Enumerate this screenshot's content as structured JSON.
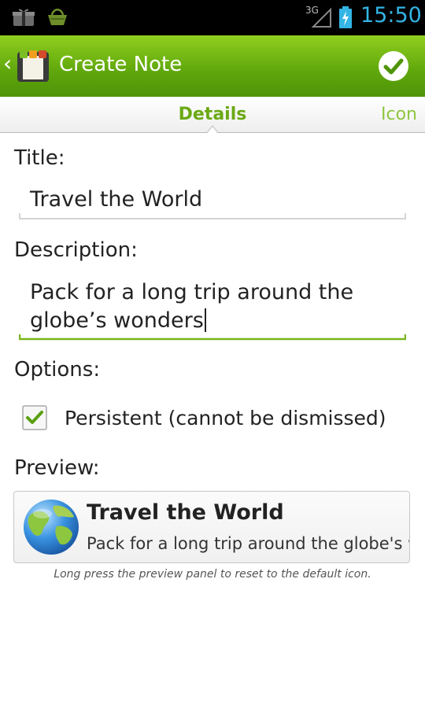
{
  "status_bar": {
    "time": "15:50",
    "network_label": "3G",
    "time_color": "#33b5e5",
    "icons": [
      "gift-icon",
      "basket-icon",
      "signal-icon",
      "battery-icon"
    ]
  },
  "action_bar": {
    "title": "Create Note",
    "back_icon": "chevron-left-icon",
    "app_icon": "notes-app-icon",
    "done_icon": "check-icon",
    "accent_color": "#5fa60c"
  },
  "tabs": [
    {
      "label": "Details",
      "selected": true
    },
    {
      "label": "Icon",
      "selected": false
    }
  ],
  "form": {
    "title_label": "Title:",
    "title_value": "Travel the World",
    "description_label": "Description:",
    "description_value": "Pack for a long trip around the globe’s wonders",
    "options_label": "Options:",
    "persistent": {
      "label": "Persistent (cannot be dismissed)",
      "checked": true
    },
    "preview_label": "Preview:"
  },
  "preview": {
    "title": "Travel the World",
    "description": "Pack for a long trip around the globe's wonders",
    "icon": "globe-icon",
    "hint": "Long press the preview panel to reset to the default icon."
  }
}
